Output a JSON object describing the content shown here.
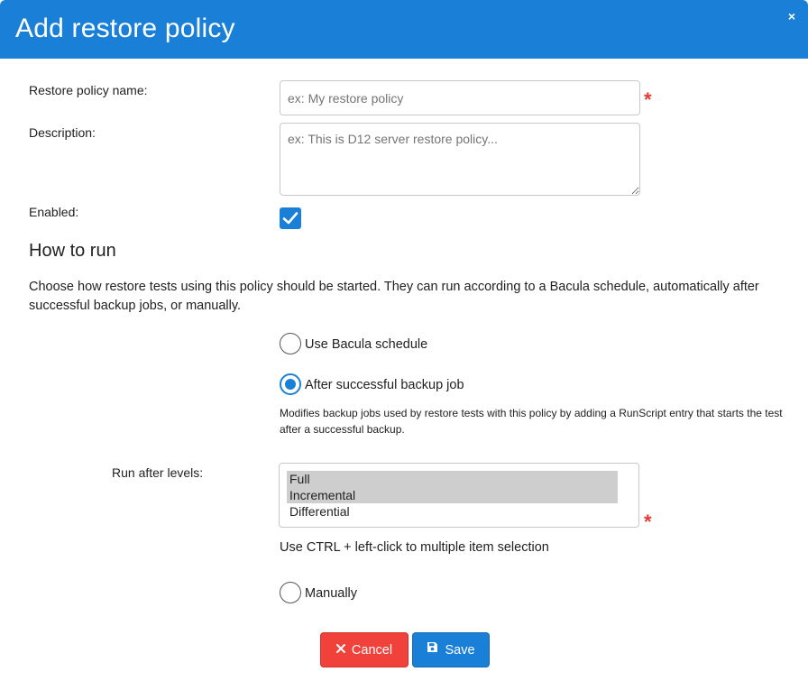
{
  "dialog": {
    "title": "Add restore policy",
    "close_label": "×"
  },
  "form": {
    "name_label": "Restore policy name:",
    "name_placeholder": "ex: My restore policy",
    "name_value": "",
    "description_label": "Description:",
    "description_placeholder": "ex: This is D12 server restore policy...",
    "description_value": "",
    "enabled_label": "Enabled:",
    "enabled_checked": true,
    "required_mark": "*"
  },
  "how_to_run": {
    "title": "How to run",
    "description": "Choose how restore tests using this policy should be started. They can run according to a Bacula schedule, automatically after successful backup jobs, or manually.",
    "options": [
      {
        "label": "Use Bacula schedule",
        "checked": false
      },
      {
        "label": "After successful backup job",
        "checked": true
      },
      {
        "label": "Manually",
        "checked": false
      }
    ],
    "after_backup_help": "Modifies backup jobs used by restore tests with this policy by adding a RunScript entry that starts the test after a successful backup.",
    "run_after_levels_label": "Run after levels:",
    "levels": [
      {
        "label": "Full",
        "selected": true
      },
      {
        "label": "Incremental",
        "selected": true
      },
      {
        "label": "Differential",
        "selected": false
      }
    ],
    "levels_hint": "Use CTRL + left-click to multiple item selection"
  },
  "buttons": {
    "cancel_label": "Cancel",
    "save_label": "Save"
  },
  "colors": {
    "primary": "#1a7fd6",
    "danger": "#f0413a",
    "required": "#e53935"
  }
}
